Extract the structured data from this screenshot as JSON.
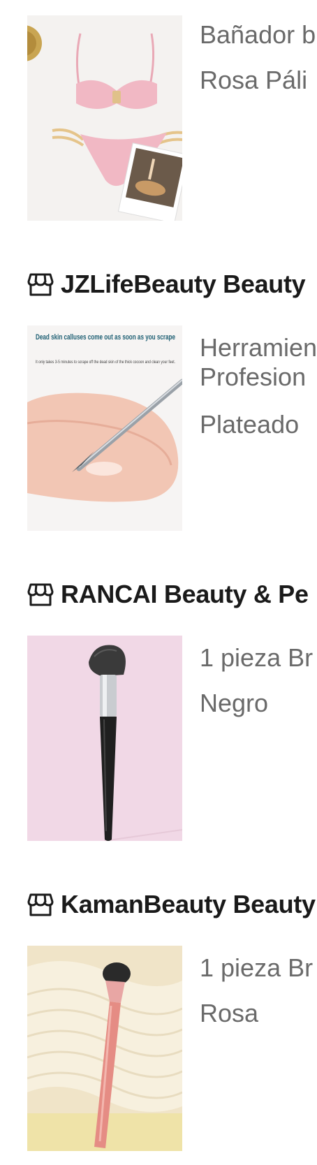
{
  "items": [
    {
      "shop": null,
      "title_line1": "Bañador b",
      "title_line2": null,
      "variant": "Rosa Páli",
      "image_icon": "pink-bikini-image",
      "image_caption": null,
      "image_subcaption": null
    },
    {
      "shop": "JZLifeBeauty Beauty",
      "title_line1": "Herramien",
      "title_line2": "Profesion",
      "variant": "Plateado",
      "image_icon": "foot-callus-scraper-image",
      "image_caption": "Dead skin calluses come out as soon as you scrape",
      "image_subcaption": "It only takes 3-5 minutes to scrape off the dead skin of the thick cocoon and clean your feet."
    },
    {
      "shop": "RANCAI Beauty & Pe",
      "title_line1": "1 pieza Br",
      "title_line2": null,
      "variant": "Negro",
      "image_icon": "black-makeup-brush-image",
      "image_caption": null,
      "image_subcaption": null
    },
    {
      "shop": "KamanBeauty Beauty",
      "title_line1": "1 pieza Br",
      "title_line2": null,
      "variant": "Rosa",
      "image_icon": "pink-makeup-brush-image",
      "image_caption": null,
      "image_subcaption": null
    }
  ],
  "icons": {
    "shop": "store-icon"
  },
  "colors": {
    "background": "#ffffff",
    "shop_name": "#1a1a1a",
    "product_text": "#6a6a6a",
    "caption_teal": "#1e5f73"
  }
}
